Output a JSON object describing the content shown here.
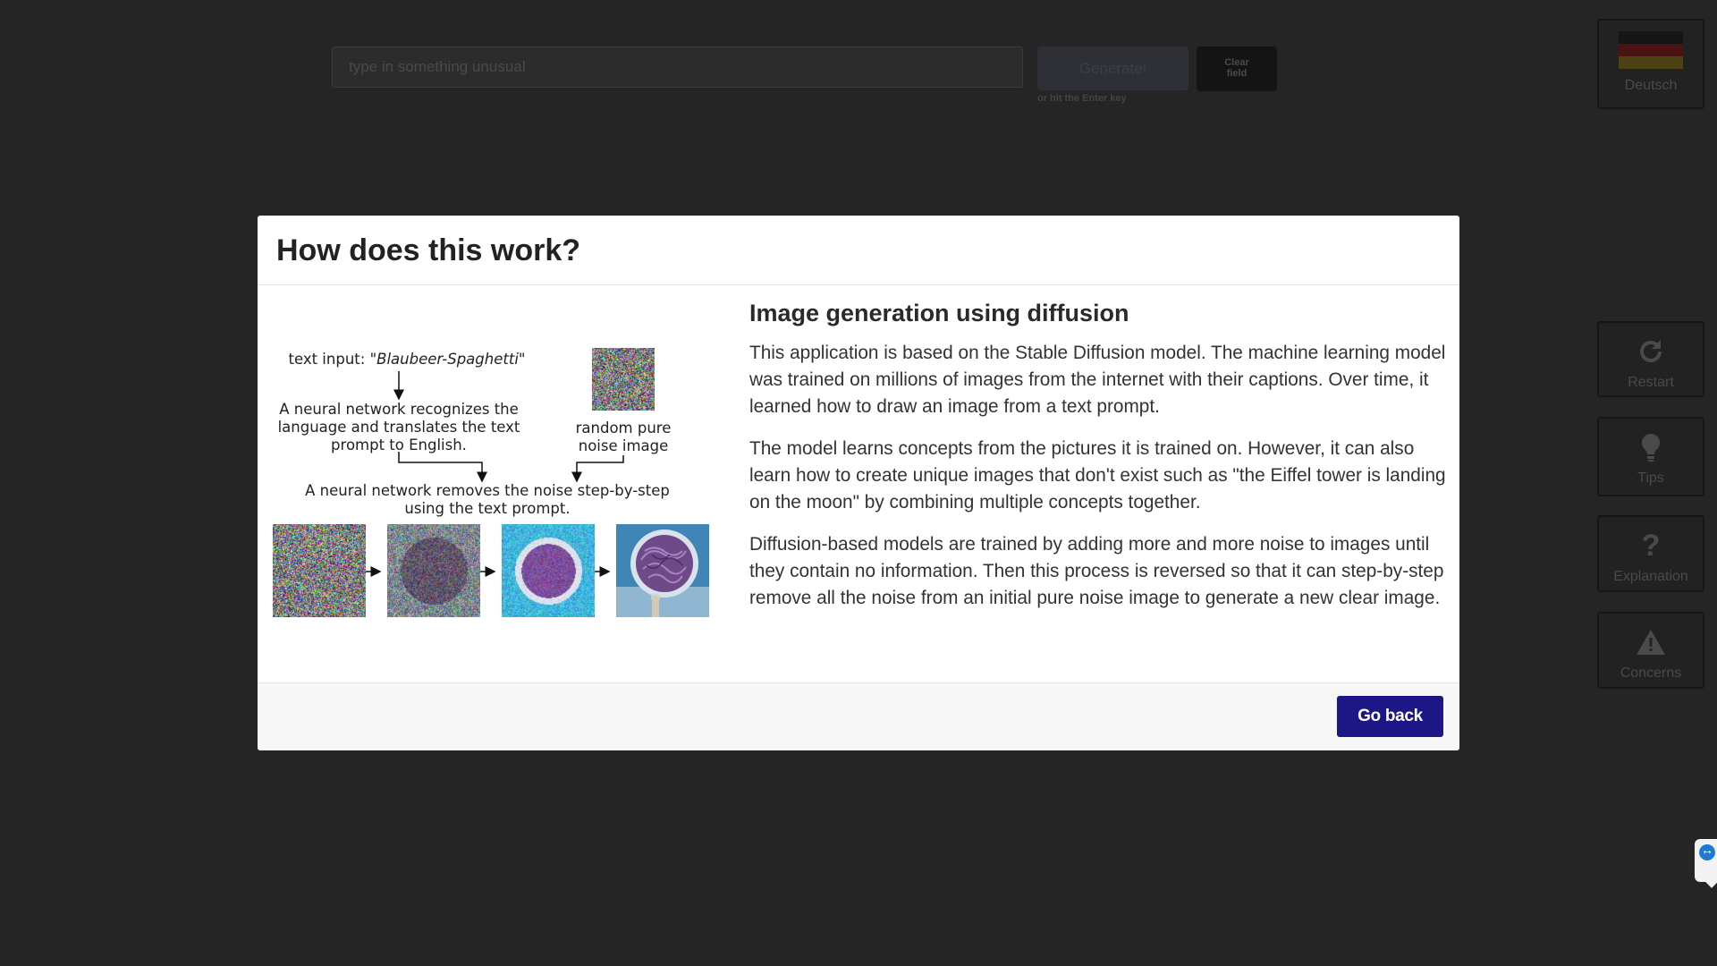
{
  "prompt": {
    "placeholder": "type in something unusual"
  },
  "generate_button": {
    "label": "Generate!"
  },
  "clear_button": {
    "line1": "Clear",
    "line2": "field"
  },
  "enter_hint": "or hit the Enter key",
  "sidebar": {
    "language": {
      "label": "Deutsch",
      "icon": "german-flag-icon"
    },
    "items": [
      {
        "label": "Restart",
        "icon": "restart-icon"
      },
      {
        "label": "Tips",
        "icon": "lightbulb-icon"
      },
      {
        "label": "Explanation",
        "icon": "question-icon"
      },
      {
        "label": "Concerns",
        "icon": "warning-icon"
      }
    ]
  },
  "modal": {
    "title": "How does this work?",
    "diagram": {
      "text_input_label": "text input: ",
      "text_input_value": "\"Blaubeer-Spaghetti\"",
      "translate_step": [
        "A neural network recognizes the",
        "language and translates the text",
        "prompt to English."
      ],
      "noise_label": [
        "random pure",
        "noise image"
      ],
      "denoise_step": [
        "A neural network removes the noise step-by-step",
        "using the text prompt."
      ]
    },
    "heading": "Image generation using diffusion",
    "paragraphs": [
      "This application is based on the Stable Diffusion model. The machine learning model was trained on millions of images from the internet with their captions. Over time, it learned how to draw an image from a text prompt.",
      "The model learns concepts from the pictures it is trained on. However, it can also learn how to create unique images that don't exist such as \"the Eiffel tower is landing on the moon\" by combining multiple concepts together.",
      "Diffusion-based models are trained by adding more and more noise to images until they contain no information. Then this process is reversed so that it can step-by-step remove all the noise from an initial pure noise image to generate a new clear image."
    ],
    "go_back_label": "Go back"
  },
  "colors": {
    "accent": "#1c1687",
    "backdrop": "#252525"
  }
}
